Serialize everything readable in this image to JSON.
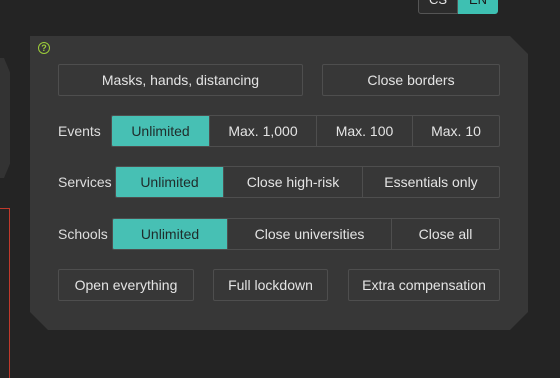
{
  "lang": {
    "cs_label": "CS",
    "en_label": "EN",
    "active": "EN"
  },
  "colors": {
    "accent": "#47c0b4",
    "panel": "#373737",
    "background": "#242424",
    "help": "#9ccc3a"
  },
  "panel": {
    "help_icon": "question-circle-icon",
    "help_glyph": "?",
    "top_buttons": [
      "Masks, hands, distancing",
      "Close borders"
    ],
    "events": {
      "label": "Events",
      "options": [
        "Unlimited",
        "Max. 1,000",
        "Max. 100",
        "Max. 10"
      ],
      "selected": "Unlimited"
    },
    "services": {
      "label": "Services",
      "options": [
        "Unlimited",
        "Close high-risk",
        "Essentials only"
      ],
      "selected": "Unlimited"
    },
    "schools": {
      "label": "Schools",
      "options": [
        "Unlimited",
        "Close universities",
        "Close all"
      ],
      "selected": "Unlimited"
    },
    "bottom_buttons": [
      "Open everything",
      "Full lockdown",
      "Extra compensation"
    ]
  }
}
